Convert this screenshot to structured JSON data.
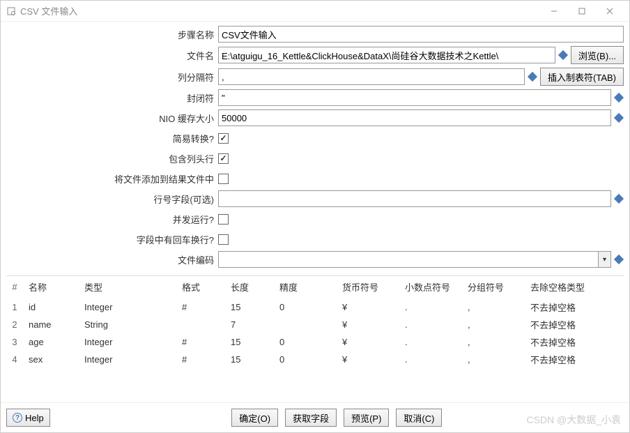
{
  "window": {
    "title": "CSV 文件输入"
  },
  "form": {
    "stepName": {
      "label": "步骤名称",
      "value": "CSV文件输入"
    },
    "fileName": {
      "label": "文件名",
      "value": "E:\\atguigu_16_Kettle&ClickHouse&DataX\\尚硅谷大数据技术之Kettle\\",
      "browse": "浏览(B)..."
    },
    "delimiter": {
      "label": "列分隔符",
      "value": ",",
      "tabBtn": "插入制表符(TAB)"
    },
    "enclosure": {
      "label": "封闭符",
      "value": "\""
    },
    "bufferSize": {
      "label": "NIO 缓存大小",
      "value": "50000"
    },
    "lazyConv": {
      "label": "简易转换?",
      "checked": true
    },
    "headerRow": {
      "label": "包含列头行",
      "checked": true
    },
    "addResult": {
      "label": "将文件添加到结果文件中",
      "checked": false
    },
    "rowNumField": {
      "label": "行号字段(可选)",
      "value": ""
    },
    "parallel": {
      "label": "并发运行?",
      "checked": false
    },
    "newlineInFields": {
      "label": "字段中有回车换行?",
      "checked": false
    },
    "encoding": {
      "label": "文件编码",
      "value": ""
    }
  },
  "table": {
    "headers": {
      "num": "#",
      "name": "名称",
      "type": "类型",
      "format": "格式",
      "length": "长度",
      "precision": "精度",
      "currency": "货币符号",
      "decimal": "小数点符号",
      "group": "分组符号",
      "trim": "去除空格类型"
    },
    "rows": [
      {
        "n": "1",
        "name": "id",
        "type": "Integer",
        "format": "#",
        "length": "15",
        "precision": "0",
        "currency": "¥",
        "decimal": ".",
        "group": ",",
        "trim": "不去掉空格"
      },
      {
        "n": "2",
        "name": "name",
        "type": "String",
        "format": "",
        "length": "7",
        "precision": "",
        "currency": "¥",
        "decimal": ".",
        "group": ",",
        "trim": "不去掉空格"
      },
      {
        "n": "3",
        "name": "age",
        "type": "Integer",
        "format": "#",
        "length": "15",
        "precision": "0",
        "currency": "¥",
        "decimal": ".",
        "group": ",",
        "trim": "不去掉空格"
      },
      {
        "n": "4",
        "name": "sex",
        "type": "Integer",
        "format": "#",
        "length": "15",
        "precision": "0",
        "currency": "¥",
        "decimal": ".",
        "group": ",",
        "trim": "不去掉空格"
      }
    ]
  },
  "footer": {
    "help": "Help",
    "ok": "确定(O)",
    "getFields": "获取字段",
    "preview": "预览(P)",
    "cancel": "取消(C)"
  },
  "watermark": "CSDN @大数据_小袁"
}
